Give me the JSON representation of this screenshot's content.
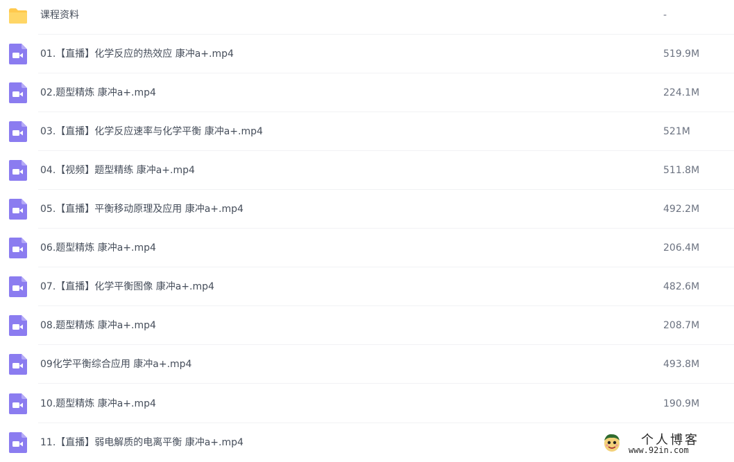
{
  "colors": {
    "folder": "#ffc94d",
    "video_icon": "#8b7cf0",
    "row_divider": "#f1f2f4"
  },
  "files": [
    {
      "name": "课程资料",
      "size": "-",
      "icon": "folder-icon"
    },
    {
      "name": "01.【直播】化学反应的热效应 康冲a+.mp4",
      "size": "519.9M",
      "icon": "video-file-icon"
    },
    {
      "name": "02.题型精炼 康冲a+.mp4",
      "size": "224.1M",
      "icon": "video-file-icon"
    },
    {
      "name": "03.【直播】化学反应速率与化学平衡 康冲a+.mp4",
      "size": "521M",
      "icon": "video-file-icon"
    },
    {
      "name": "04.【视频】题型精练 康冲a+.mp4",
      "size": "511.8M",
      "icon": "video-file-icon"
    },
    {
      "name": "05.【直播】平衡移动原理及应用 康冲a+.mp4",
      "size": "492.2M",
      "icon": "video-file-icon"
    },
    {
      "name": "06.题型精炼 康冲a+.mp4",
      "size": "206.4M",
      "icon": "video-file-icon"
    },
    {
      "name": "07.【直播】化学平衡图像 康冲a+.mp4",
      "size": "482.6M",
      "icon": "video-file-icon"
    },
    {
      "name": "08.题型精炼 康冲a+.mp4",
      "size": "208.7M",
      "icon": "video-file-icon"
    },
    {
      "name": "09化学平衡综合应用 康冲a+.mp4",
      "size": "493.8M",
      "icon": "video-file-icon"
    },
    {
      "name": "10.题型精炼 康冲a+.mp4",
      "size": "190.9M",
      "icon": "video-file-icon"
    },
    {
      "name": "11.【直播】弱电解质的电离平衡 康冲a+.mp4",
      "size": "",
      "icon": "video-file-icon"
    }
  ],
  "watermark": {
    "title": "个人博客",
    "url": "www.92in.com"
  }
}
